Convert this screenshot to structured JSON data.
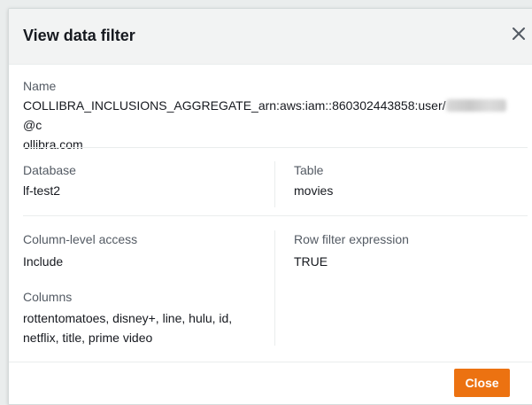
{
  "modal": {
    "title": "View data filter",
    "close_icon": "close-icon"
  },
  "name": {
    "label": "Name",
    "value_prefix": "COLLIBRA_INCLUSIONS_AGGREGATE_arn:aws:iam::860302443858:user/",
    "value_suffix": "@c",
    "value_line2": "ollibra.com"
  },
  "database": {
    "label": "Database",
    "value": "lf-test2"
  },
  "table": {
    "label": "Table",
    "value": "movies"
  },
  "column_access": {
    "label": "Column-level access",
    "value": "Include"
  },
  "row_filter": {
    "label": "Row filter expression",
    "value": "TRUE"
  },
  "columns": {
    "label": "Columns",
    "line1": "rottentomatoes, disney+, line, hulu, id,",
    "line2": "netflix, title, prime video"
  },
  "footer": {
    "close_label": "Close"
  },
  "colors": {
    "accent": "#ec7211",
    "text": "#16191f",
    "label": "#545b64"
  }
}
